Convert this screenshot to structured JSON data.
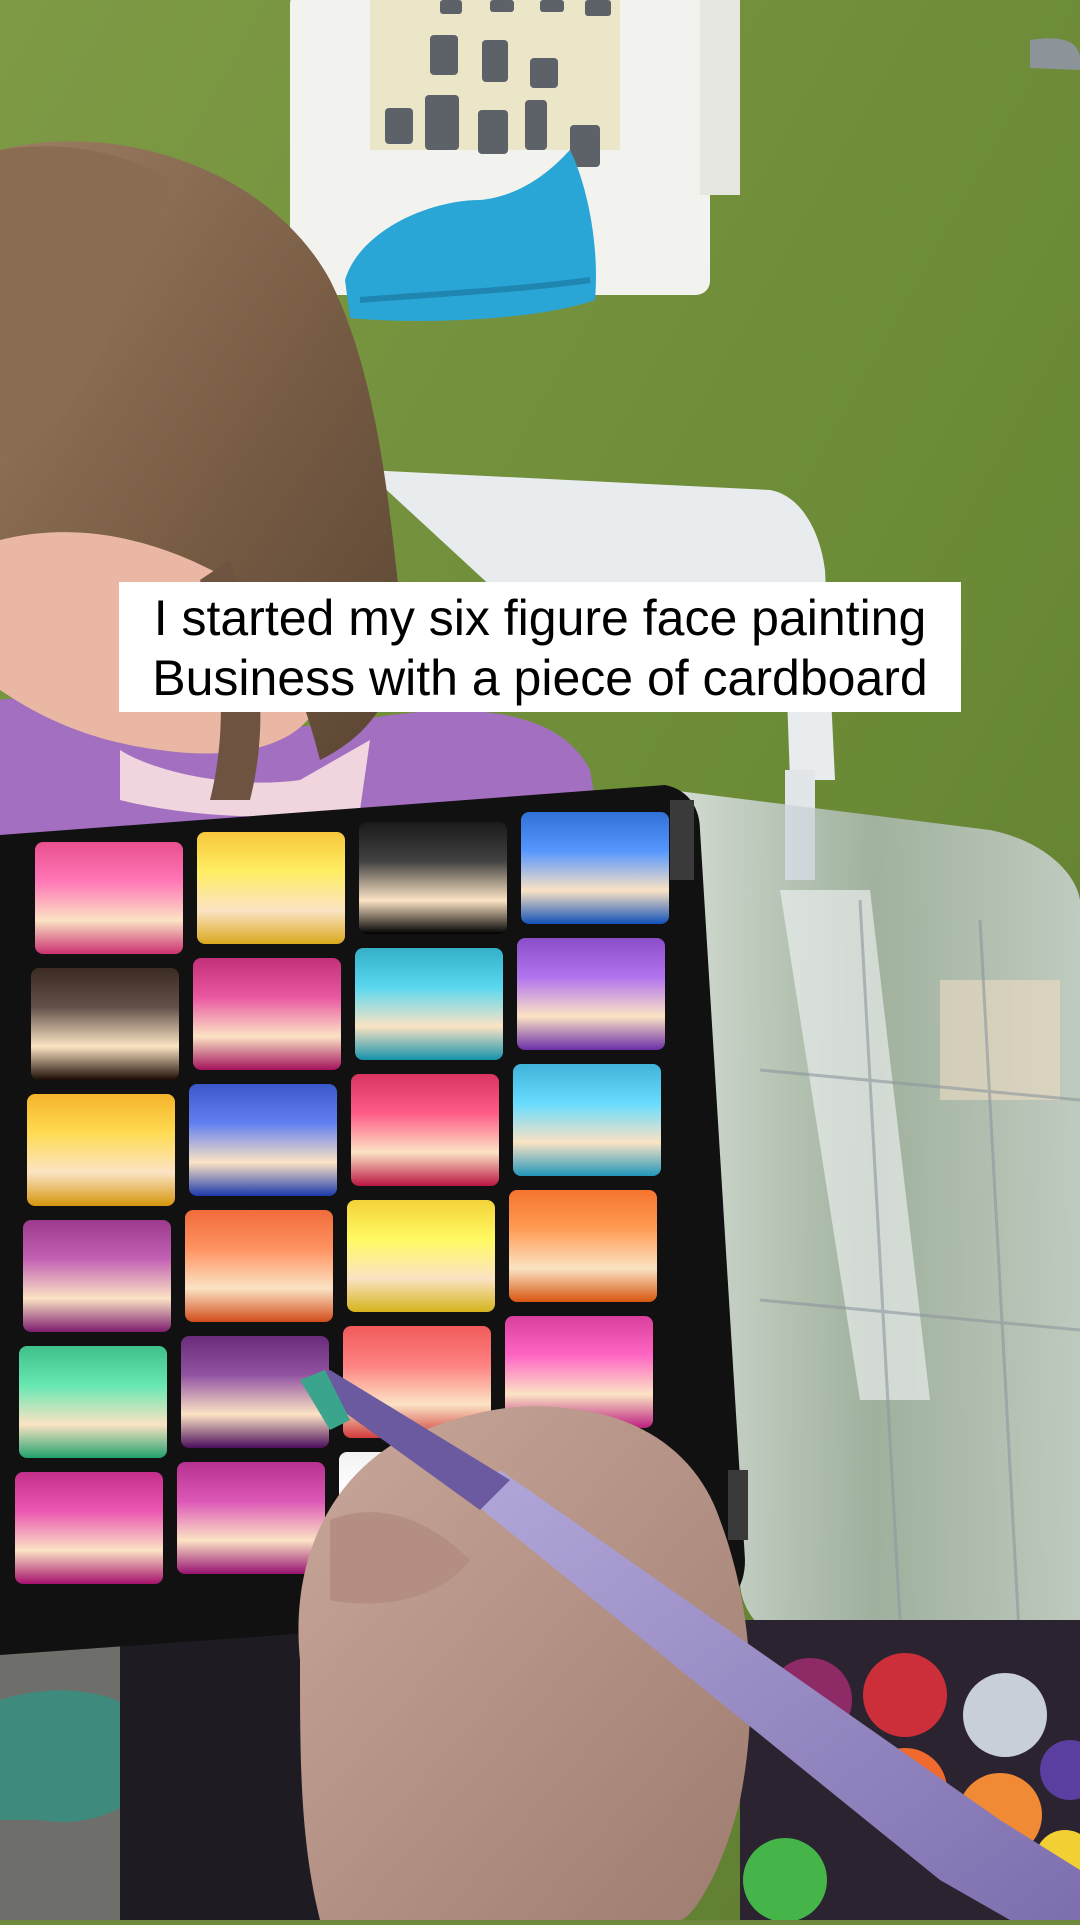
{
  "caption": {
    "line1": "I started my six figure face painting",
    "line2": "Business with a piece of cardboard"
  },
  "colors": {
    "grass": "#6f8a3c",
    "caption_background": "#ffffff",
    "caption_text": "#000000",
    "palette_frame": "#111111",
    "brush_handle": "#9a8cc4",
    "bag": "#2aa6d6"
  },
  "palette": {
    "cakes": [
      [
        "#e94f8f",
        "#f7c63b",
        "#1a1a1a",
        "#2f6fd6"
      ],
      [
        "#3a2a22",
        "#c2307a",
        "#33b0c8",
        "#8a4cc7"
      ],
      [
        "#f4b32a",
        "#3a58c9",
        "#d8345f",
        "#3fb4d8"
      ],
      [
        "#9b3a8c",
        "#f06b3a",
        "#f3d23a",
        "#f5742d"
      ],
      [
        "#3fc08a",
        "#6a2c7a",
        "#f05a5a",
        "#d93e9c"
      ],
      [
        "#c32f8a",
        "#b5308f",
        "#f2f2f2",
        "#4cbf4a"
      ]
    ]
  }
}
